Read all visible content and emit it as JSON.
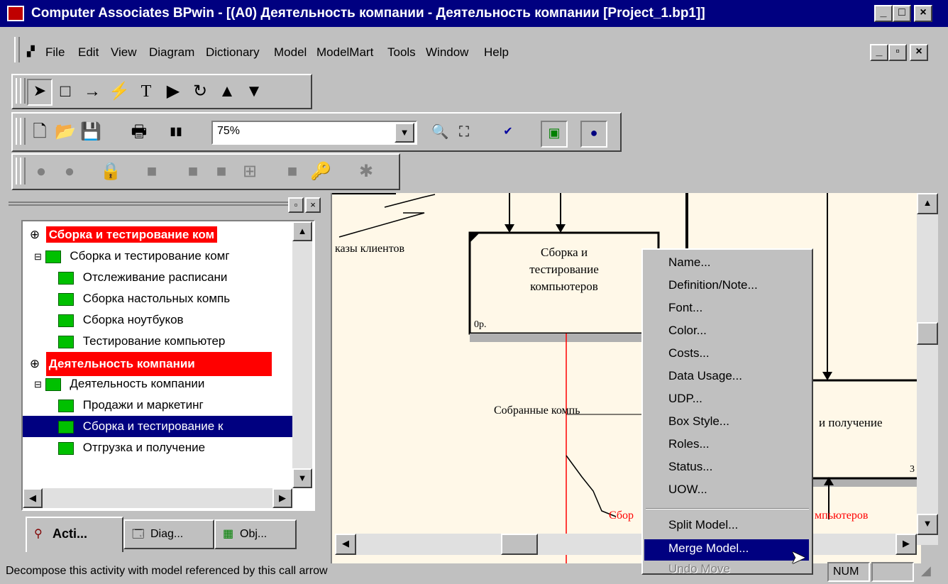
{
  "window": {
    "title": "Computer Associates BPwin - [(A0) Деятельность компании - Деятельность компании  [Project_1.bp1]]"
  },
  "menu": {
    "items": [
      "File",
      "Edit",
      "View",
      "Diagram",
      "Dictionary",
      "Model",
      "ModelMart",
      "Tools",
      "Window",
      "Help"
    ]
  },
  "toolbar": {
    "zoom": "75%"
  },
  "tree": {
    "model1": "Сборка и тестирование ком",
    "model1_root": "Сборка и тестирование  комг",
    "model1_children": [
      "Отслеживание  расписани",
      "Сборка настольных компь",
      "Сборка ноутбуков",
      "Тестирование  компьютер"
    ],
    "model2": "Деятельность компании",
    "model2_root": "Деятельность компании",
    "model2_children": [
      "Продажи и маркетинг",
      "Сборка и тестирование  к",
      "Отгрузка и получение"
    ]
  },
  "tabs": [
    "Acti...",
    "Diag...",
    "Obj..."
  ],
  "diagram": {
    "label_orders": "казы клиентов",
    "box1_line1": "Сборка и",
    "box1_line2": "тестирование",
    "box1_line3": "компьютеров",
    "box1_ref": "0р.",
    "label_assembled": "Собранные компь",
    "label_shipping": "и получение",
    "label_red1": "Сбор",
    "label_red2": "мпьютеров",
    "box2_num": "3"
  },
  "context_menu": {
    "items": [
      "Name...",
      "Definition/Note...",
      "Font...",
      "Color...",
      "Costs...",
      "Data Usage...",
      "UDP...",
      "Box Style...",
      "Roles...",
      "Status...",
      "UOW..."
    ],
    "items2": [
      "Split Model...",
      "Merge Model..."
    ],
    "disabled": "Undo Move"
  },
  "status": {
    "message": "Decompose this activity with model referenced by this call arrow",
    "num": "NUM"
  },
  "colors": {
    "titlebar": "#000080",
    "highlight": "#ff0000",
    "selection": "#000080"
  }
}
